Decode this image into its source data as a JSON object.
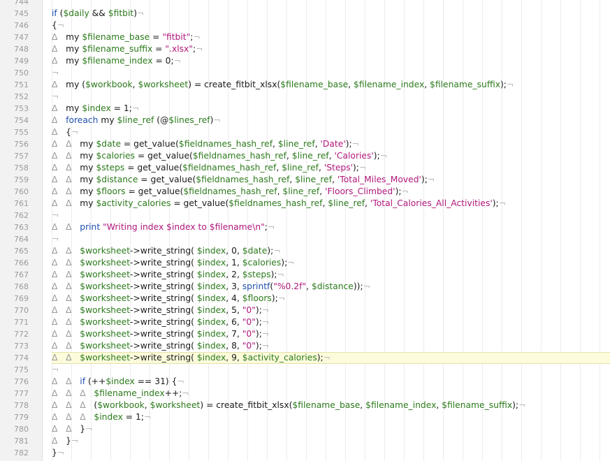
{
  "editor": {
    "lines": [
      {
        "n": "744",
        "t": [
          [
            "plain",
            ""
          ]
        ]
      },
      {
        "n": "745",
        "t": [
          [
            "kw",
            "if"
          ],
          [
            "plain",
            " ("
          ],
          [
            "var",
            "$daily"
          ],
          [
            "plain",
            " && "
          ],
          [
            "var",
            "$fitbit"
          ],
          [
            "plain",
            ")"
          ],
          [
            "eol",
            "¬"
          ]
        ]
      },
      {
        "n": "746",
        "t": [
          [
            "plain",
            "{"
          ],
          [
            "eol",
            "¬"
          ]
        ]
      },
      {
        "n": "747",
        "t": [
          [
            "tab",
            "Δ   "
          ],
          [
            "plain",
            "my "
          ],
          [
            "var",
            "$filename_base"
          ],
          [
            "plain",
            " = "
          ],
          [
            "str",
            "\"fitbit\""
          ],
          [
            "plain",
            ";"
          ],
          [
            "eol",
            "¬"
          ]
        ]
      },
      {
        "n": "748",
        "t": [
          [
            "tab",
            "Δ   "
          ],
          [
            "plain",
            "my "
          ],
          [
            "var",
            "$filename_suffix"
          ],
          [
            "plain",
            " = "
          ],
          [
            "str",
            "\".xlsx\""
          ],
          [
            "plain",
            ";"
          ],
          [
            "eol",
            "¬"
          ]
        ]
      },
      {
        "n": "749",
        "t": [
          [
            "tab",
            "Δ   "
          ],
          [
            "plain",
            "my "
          ],
          [
            "var",
            "$filename_index"
          ],
          [
            "plain",
            " = 0;"
          ],
          [
            "eol",
            "¬"
          ]
        ]
      },
      {
        "n": "750",
        "t": [
          [
            "eol",
            "¬"
          ]
        ]
      },
      {
        "n": "751",
        "t": [
          [
            "tab",
            "Δ   "
          ],
          [
            "plain",
            "my ("
          ],
          [
            "var",
            "$workbook"
          ],
          [
            "plain",
            ", "
          ],
          [
            "var",
            "$worksheet"
          ],
          [
            "plain",
            ") = create_fitbit_xlsx("
          ],
          [
            "var",
            "$filename_base"
          ],
          [
            "plain",
            ", "
          ],
          [
            "var",
            "$filename_index"
          ],
          [
            "plain",
            ", "
          ],
          [
            "var",
            "$filename_suffix"
          ],
          [
            "plain",
            ");"
          ],
          [
            "eol",
            "¬"
          ]
        ]
      },
      {
        "n": "752",
        "t": [
          [
            "eol",
            "¬"
          ]
        ]
      },
      {
        "n": "753",
        "t": [
          [
            "tab",
            "Δ   "
          ],
          [
            "plain",
            "my "
          ],
          [
            "var",
            "$index"
          ],
          [
            "plain",
            " = 1;"
          ],
          [
            "eol",
            "¬"
          ]
        ]
      },
      {
        "n": "754",
        "t": [
          [
            "tab",
            "Δ   "
          ],
          [
            "kw",
            "foreach"
          ],
          [
            "plain",
            " my "
          ],
          [
            "var",
            "$line_ref"
          ],
          [
            "plain",
            " (@"
          ],
          [
            "var",
            "$lines_ref"
          ],
          [
            "plain",
            ")"
          ],
          [
            "eol",
            "¬"
          ]
        ]
      },
      {
        "n": "755",
        "t": [
          [
            "tab",
            "Δ   "
          ],
          [
            "plain",
            "{"
          ],
          [
            "eol",
            "¬"
          ]
        ]
      },
      {
        "n": "756",
        "t": [
          [
            "tab",
            "Δ   Δ   "
          ],
          [
            "plain",
            "my "
          ],
          [
            "var",
            "$date"
          ],
          [
            "plain",
            " = get_value("
          ],
          [
            "var",
            "$fieldnames_hash_ref"
          ],
          [
            "plain",
            ", "
          ],
          [
            "var",
            "$line_ref"
          ],
          [
            "plain",
            ", "
          ],
          [
            "str",
            "'Date'"
          ],
          [
            "plain",
            ");"
          ],
          [
            "eol",
            "¬"
          ]
        ]
      },
      {
        "n": "757",
        "t": [
          [
            "tab",
            "Δ   Δ   "
          ],
          [
            "plain",
            "my "
          ],
          [
            "var",
            "$calories"
          ],
          [
            "plain",
            " = get_value("
          ],
          [
            "var",
            "$fieldnames_hash_ref"
          ],
          [
            "plain",
            ", "
          ],
          [
            "var",
            "$line_ref"
          ],
          [
            "plain",
            ", "
          ],
          [
            "str",
            "'Calories'"
          ],
          [
            "plain",
            ");"
          ],
          [
            "eol",
            "¬"
          ]
        ]
      },
      {
        "n": "758",
        "t": [
          [
            "tab",
            "Δ   Δ   "
          ],
          [
            "plain",
            "my "
          ],
          [
            "var",
            "$steps"
          ],
          [
            "plain",
            " = get_value("
          ],
          [
            "var",
            "$fieldnames_hash_ref"
          ],
          [
            "plain",
            ", "
          ],
          [
            "var",
            "$line_ref"
          ],
          [
            "plain",
            ", "
          ],
          [
            "str",
            "'Steps'"
          ],
          [
            "plain",
            ");"
          ],
          [
            "eol",
            "¬"
          ]
        ]
      },
      {
        "n": "759",
        "t": [
          [
            "tab",
            "Δ   Δ   "
          ],
          [
            "plain",
            "my "
          ],
          [
            "var",
            "$distance"
          ],
          [
            "plain",
            " = get_value("
          ],
          [
            "var",
            "$fieldnames_hash_ref"
          ],
          [
            "plain",
            ", "
          ],
          [
            "var",
            "$line_ref"
          ],
          [
            "plain",
            ", "
          ],
          [
            "str",
            "'Total_Miles_Moved'"
          ],
          [
            "plain",
            ");"
          ],
          [
            "eol",
            "¬"
          ]
        ]
      },
      {
        "n": "760",
        "t": [
          [
            "tab",
            "Δ   Δ   "
          ],
          [
            "plain",
            "my "
          ],
          [
            "var",
            "$floors"
          ],
          [
            "plain",
            " = get_value("
          ],
          [
            "var",
            "$fieldnames_hash_ref"
          ],
          [
            "plain",
            ", "
          ],
          [
            "var",
            "$line_ref"
          ],
          [
            "plain",
            ", "
          ],
          [
            "str",
            "'Floors_Climbed'"
          ],
          [
            "plain",
            ");"
          ],
          [
            "eol",
            "¬"
          ]
        ]
      },
      {
        "n": "761",
        "t": [
          [
            "tab",
            "Δ   Δ   "
          ],
          [
            "plain",
            "my "
          ],
          [
            "var",
            "$activity_calories"
          ],
          [
            "plain",
            " = get_value("
          ],
          [
            "var",
            "$fieldnames_hash_ref"
          ],
          [
            "plain",
            ", "
          ],
          [
            "var",
            "$line_ref"
          ],
          [
            "plain",
            ", "
          ],
          [
            "str",
            "'Total_Calories_All_Activities'"
          ],
          [
            "plain",
            ");"
          ],
          [
            "eol",
            "¬"
          ]
        ]
      },
      {
        "n": "762",
        "t": [
          [
            "eol",
            "¬"
          ]
        ]
      },
      {
        "n": "763",
        "t": [
          [
            "tab",
            "Δ   Δ   "
          ],
          [
            "kw",
            "print"
          ],
          [
            "plain",
            " "
          ],
          [
            "str",
            "\"Writing index $index to $filename\\n\""
          ],
          [
            "plain",
            ";"
          ],
          [
            "eol",
            "¬"
          ]
        ]
      },
      {
        "n": "764",
        "t": [
          [
            "eol",
            "¬"
          ]
        ]
      },
      {
        "n": "765",
        "t": [
          [
            "tab",
            "Δ   Δ   "
          ],
          [
            "var",
            "$worksheet"
          ],
          [
            "plain",
            "->write_string( "
          ],
          [
            "var",
            "$index"
          ],
          [
            "plain",
            ", 0, "
          ],
          [
            "var",
            "$date"
          ],
          [
            "plain",
            ");"
          ],
          [
            "eol",
            "¬"
          ]
        ]
      },
      {
        "n": "766",
        "t": [
          [
            "tab",
            "Δ   Δ   "
          ],
          [
            "var",
            "$worksheet"
          ],
          [
            "plain",
            "->write_string( "
          ],
          [
            "var",
            "$index"
          ],
          [
            "plain",
            ", 1, "
          ],
          [
            "var",
            "$calories"
          ],
          [
            "plain",
            ");"
          ],
          [
            "eol",
            "¬"
          ]
        ]
      },
      {
        "n": "767",
        "t": [
          [
            "tab",
            "Δ   Δ   "
          ],
          [
            "var",
            "$worksheet"
          ],
          [
            "plain",
            "->write_string( "
          ],
          [
            "var",
            "$index"
          ],
          [
            "plain",
            ", 2, "
          ],
          [
            "var",
            "$steps"
          ],
          [
            "plain",
            ");"
          ],
          [
            "eol",
            "¬"
          ]
        ]
      },
      {
        "n": "768",
        "t": [
          [
            "tab",
            "Δ   Δ   "
          ],
          [
            "var",
            "$worksheet"
          ],
          [
            "plain",
            "->write_string( "
          ],
          [
            "var",
            "$index"
          ],
          [
            "plain",
            ", 3, "
          ],
          [
            "kw",
            "sprintf"
          ],
          [
            "plain",
            "("
          ],
          [
            "str",
            "\"%0.2f\""
          ],
          [
            "plain",
            ", "
          ],
          [
            "var",
            "$distance"
          ],
          [
            "plain",
            "));"
          ],
          [
            "eol",
            "¬"
          ]
        ]
      },
      {
        "n": "769",
        "t": [
          [
            "tab",
            "Δ   Δ   "
          ],
          [
            "var",
            "$worksheet"
          ],
          [
            "plain",
            "->write_string( "
          ],
          [
            "var",
            "$index"
          ],
          [
            "plain",
            ", 4, "
          ],
          [
            "var",
            "$floors"
          ],
          [
            "plain",
            ");"
          ],
          [
            "eol",
            "¬"
          ]
        ]
      },
      {
        "n": "770",
        "t": [
          [
            "tab",
            "Δ   Δ   "
          ],
          [
            "var",
            "$worksheet"
          ],
          [
            "plain",
            "->write_string( "
          ],
          [
            "var",
            "$index"
          ],
          [
            "plain",
            ", 5, "
          ],
          [
            "str",
            "\"0\""
          ],
          [
            "plain",
            ");"
          ],
          [
            "eol",
            "¬"
          ]
        ]
      },
      {
        "n": "771",
        "t": [
          [
            "tab",
            "Δ   Δ   "
          ],
          [
            "var",
            "$worksheet"
          ],
          [
            "plain",
            "->write_string( "
          ],
          [
            "var",
            "$index"
          ],
          [
            "plain",
            ", 6, "
          ],
          [
            "str",
            "\"0\""
          ],
          [
            "plain",
            ");"
          ],
          [
            "eol",
            "¬"
          ]
        ]
      },
      {
        "n": "772",
        "t": [
          [
            "tab",
            "Δ   Δ   "
          ],
          [
            "var",
            "$worksheet"
          ],
          [
            "plain",
            "->write_string( "
          ],
          [
            "var",
            "$index"
          ],
          [
            "plain",
            ", 7, "
          ],
          [
            "str",
            "\"0\""
          ],
          [
            "plain",
            ");"
          ],
          [
            "eol",
            "¬"
          ]
        ]
      },
      {
        "n": "773",
        "t": [
          [
            "tab",
            "Δ   Δ   "
          ],
          [
            "var",
            "$worksheet"
          ],
          [
            "plain",
            "->write_string( "
          ],
          [
            "var",
            "$index"
          ],
          [
            "plain",
            ", 8, "
          ],
          [
            "str",
            "\"0\""
          ],
          [
            "plain",
            ");"
          ],
          [
            "eol",
            "¬"
          ]
        ]
      },
      {
        "n": "774",
        "current": true,
        "t": [
          [
            "tab",
            "Δ   Δ   "
          ],
          [
            "var",
            "$worksheet"
          ],
          [
            "plain",
            "->write_string( "
          ],
          [
            "var",
            "$index"
          ],
          [
            "plain",
            ", 9, "
          ],
          [
            "var",
            "$activity_calories"
          ],
          [
            "plain",
            ");"
          ],
          [
            "eol",
            "¬"
          ]
        ]
      },
      {
        "n": "775",
        "t": [
          [
            "eol",
            "¬"
          ]
        ]
      },
      {
        "n": "776",
        "t": [
          [
            "tab",
            "Δ   Δ   "
          ],
          [
            "kw",
            "if"
          ],
          [
            "plain",
            " (++"
          ],
          [
            "var",
            "$index"
          ],
          [
            "plain",
            " == 31) {"
          ],
          [
            "eol",
            "¬"
          ]
        ]
      },
      {
        "n": "777",
        "t": [
          [
            "tab",
            "Δ   Δ   Δ   "
          ],
          [
            "var",
            "$filename_index"
          ],
          [
            "plain",
            "++;"
          ],
          [
            "eol",
            "¬"
          ]
        ]
      },
      {
        "n": "778",
        "t": [
          [
            "tab",
            "Δ   Δ   Δ   "
          ],
          [
            "plain",
            "("
          ],
          [
            "var",
            "$workbook"
          ],
          [
            "plain",
            ", "
          ],
          [
            "var",
            "$worksheet"
          ],
          [
            "plain",
            ") = create_fitbit_xlsx("
          ],
          [
            "var",
            "$filename_base"
          ],
          [
            "plain",
            ", "
          ],
          [
            "var",
            "$filename_index"
          ],
          [
            "plain",
            ", "
          ],
          [
            "var",
            "$filename_suffix"
          ],
          [
            "plain",
            ");"
          ],
          [
            "eol",
            "¬"
          ]
        ]
      },
      {
        "n": "779",
        "t": [
          [
            "tab",
            "Δ   Δ   Δ   "
          ],
          [
            "var",
            "$index"
          ],
          [
            "plain",
            " = 1;"
          ],
          [
            "eol",
            "¬"
          ]
        ]
      },
      {
        "n": "780",
        "t": [
          [
            "tab",
            "Δ   Δ   "
          ],
          [
            "plain",
            "}"
          ],
          [
            "eol",
            "¬"
          ]
        ]
      },
      {
        "n": "781",
        "t": [
          [
            "tab",
            "Δ   "
          ],
          [
            "plain",
            "}"
          ],
          [
            "eol",
            "¬"
          ]
        ]
      },
      {
        "n": "782",
        "t": [
          [
            "plain",
            "}"
          ],
          [
            "eol",
            "¬"
          ]
        ]
      }
    ]
  }
}
